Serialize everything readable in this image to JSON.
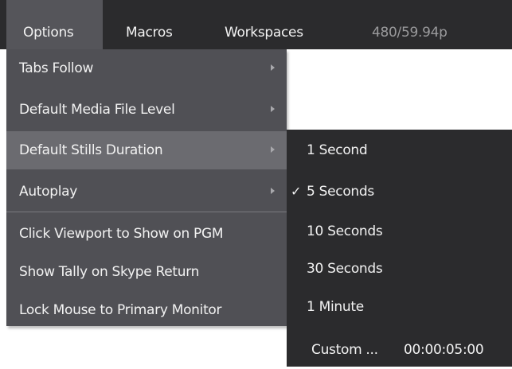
{
  "menubar": {
    "items": [
      {
        "label": "Options"
      },
      {
        "label": "Macros"
      },
      {
        "label": "Workspaces"
      }
    ],
    "format": "480/59.94p"
  },
  "options_menu": {
    "items": [
      {
        "label": "Tabs Follow",
        "submenu": true
      },
      {
        "label": "Default Media File Level",
        "submenu": true
      },
      {
        "label": "Default Stills Duration",
        "submenu": true,
        "highlighted": true
      },
      {
        "label": "Autoplay",
        "submenu": true
      },
      {
        "label": "Click Viewport to Show on PGM",
        "submenu": false
      },
      {
        "label": "Show Tally on Skype Return",
        "submenu": false
      },
      {
        "label": "Lock Mouse to Primary Monitor",
        "submenu": false
      }
    ]
  },
  "stills_duration_menu": {
    "options": [
      {
        "label": "1 Second",
        "checked": false
      },
      {
        "label": "5 Seconds",
        "checked": true
      },
      {
        "label": "10 Seconds",
        "checked": false
      },
      {
        "label": "30 Seconds",
        "checked": false
      },
      {
        "label": "1 Minute",
        "checked": false
      }
    ],
    "custom_label": "Custom ...",
    "custom_value": "00:00:05:00",
    "check_mark": "✓"
  },
  "colors": {
    "menubar_bg": "#2b2b2d",
    "menu_bg": "#505055",
    "highlight_bg": "#6b6b70",
    "active_menu_bg": "#55555a"
  }
}
